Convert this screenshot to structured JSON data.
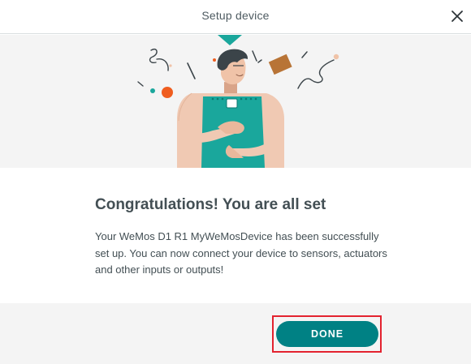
{
  "dialog": {
    "title": "Setup device",
    "close_icon": "close-icon"
  },
  "illustration": {
    "icon": "person-holding-board-illustration",
    "colors": {
      "board": "#1aa79c",
      "skin": "#efc7b0",
      "hair": "#3b4449",
      "accent_orange": "#ef5d1f",
      "box": "#b87436"
    }
  },
  "content": {
    "heading": "Congratulations! You are all set",
    "message": "Your WeMos D1 R1 MyWeMosDevice has been successfully set up. You can now connect your device to sensors, actuators and other inputs or outputs!"
  },
  "footer": {
    "done_label": "DONE"
  },
  "colors": {
    "primary": "#008184",
    "highlight": "#e3232f",
    "panel_background": "#f4f4f4"
  }
}
